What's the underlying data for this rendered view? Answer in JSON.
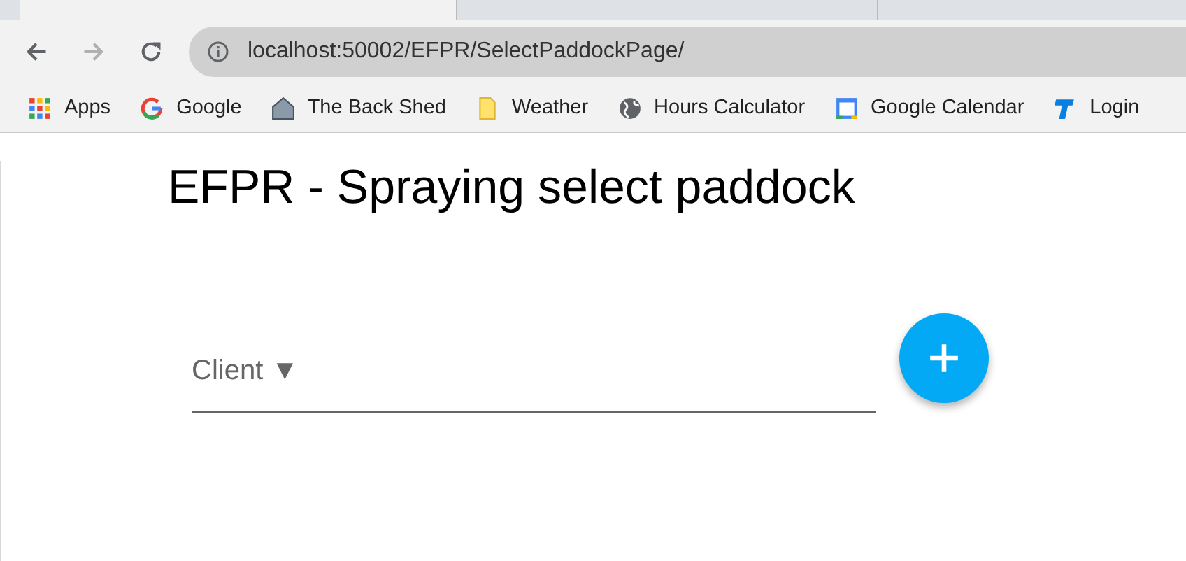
{
  "browser": {
    "address": "localhost:50002/EFPR/SelectPaddockPage/",
    "bookmarks": [
      {
        "label": "Apps",
        "kind": "apps"
      },
      {
        "label": "Google",
        "kind": "google"
      },
      {
        "label": "The Back Shed",
        "kind": "house"
      },
      {
        "label": "Weather",
        "kind": "note"
      },
      {
        "label": "Hours Calculator",
        "kind": "globe"
      },
      {
        "label": "Google Calendar",
        "kind": "calendar"
      },
      {
        "label": "Login",
        "kind": "t"
      }
    ]
  },
  "page": {
    "title": "EFPR - Spraying select paddock",
    "client_picker": {
      "label": "Client ▼"
    }
  }
}
